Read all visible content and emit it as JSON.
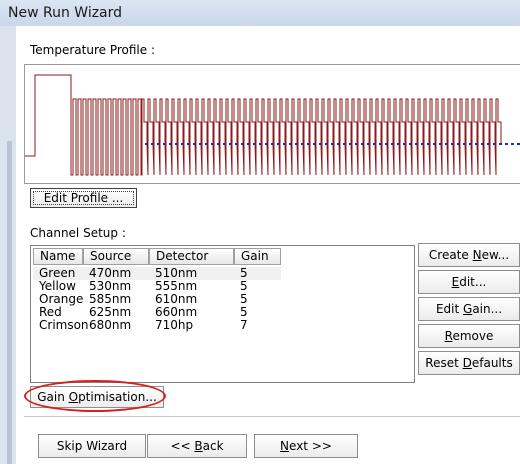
{
  "window": {
    "title": "New Run Wizard"
  },
  "profile": {
    "label": "Temperature Profile :",
    "edit_button": "Edit Profile ..."
  },
  "channel": {
    "label": "Channel Setup :",
    "columns": [
      "Name",
      "Source",
      "Detector",
      "Gain"
    ],
    "rows": [
      {
        "name": "Green",
        "source": "470nm",
        "detector": "510nm",
        "gain": "5"
      },
      {
        "name": "Yellow",
        "source": "530nm",
        "detector": "555nm",
        "gain": "5"
      },
      {
        "name": "Orange",
        "source": "585nm",
        "detector": "610nm",
        "gain": "5"
      },
      {
        "name": "Red",
        "source": "625nm",
        "detector": "660nm",
        "gain": "5"
      },
      {
        "name": "Crimson",
        "source": "680nm",
        "detector": "710hp",
        "gain": "7"
      }
    ],
    "buttons": {
      "create_new_pre": "Create ",
      "create_new_u": "N",
      "create_new_post": "ew...",
      "edit_pre": "",
      "edit_u": "E",
      "edit_post": "dit...",
      "edit_gain_pre": "Edit ",
      "edit_gain_u": "G",
      "edit_gain_post": "ain...",
      "remove_pre": "",
      "remove_u": "R",
      "remove_post": "emove",
      "reset_pre": "Reset ",
      "reset_u": "D",
      "reset_post": "efaults"
    }
  },
  "gain_opt": {
    "pre": "Gain ",
    "u": "O",
    "post": "ptimisation..."
  },
  "nav": {
    "skip": "Skip Wizard",
    "back_pre": "<< ",
    "back_u": "B",
    "back_post": "ack",
    "next_pre": "",
    "next_u": "N",
    "next_post": "ext >>"
  },
  "colors": {
    "profile_line": "#8b1a1a",
    "acquire_marker": "#1f2fa8",
    "highlight": "#d42020"
  }
}
